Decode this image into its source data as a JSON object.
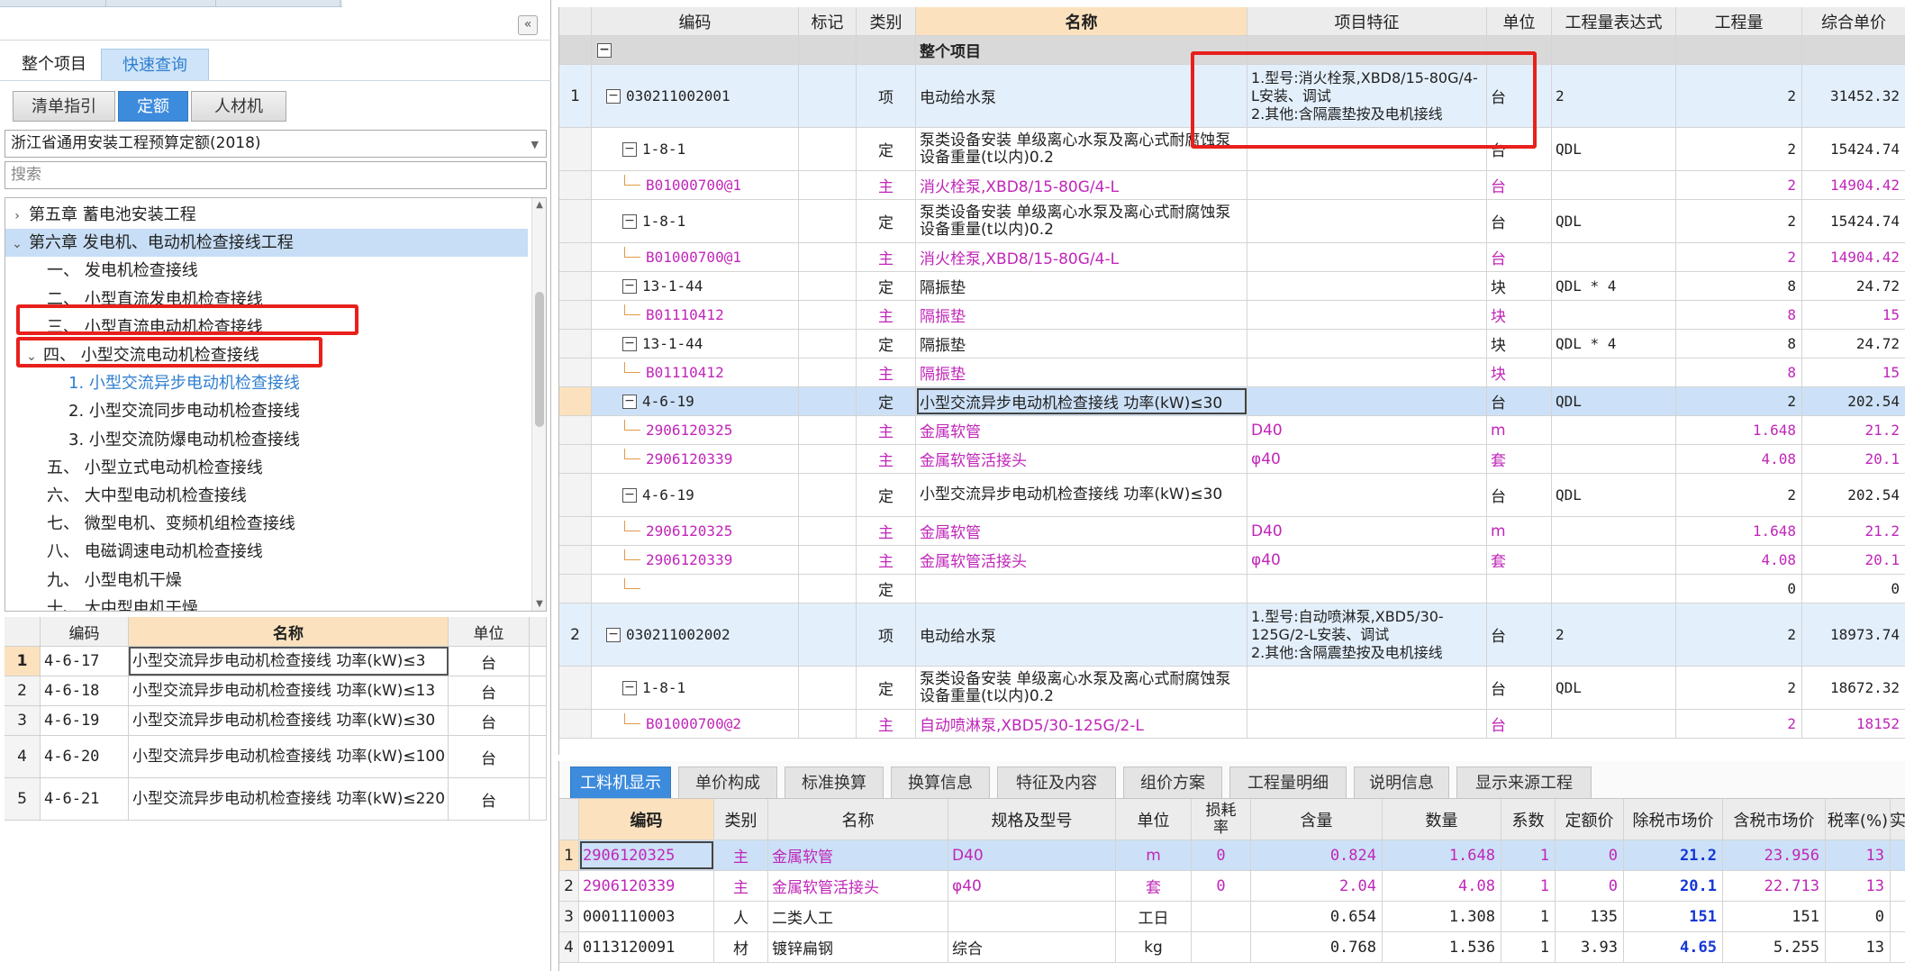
{
  "colors": {
    "accent": "#3d8bdc",
    "highlight_orange": "#fbe1bd",
    "main_material": "#c026b9",
    "red_annotation": "#e8201c",
    "bold_price": "#1437d6"
  },
  "left": {
    "collapse_icon": "«",
    "top_tabs": [
      "整个项目",
      "快速查询"
    ],
    "sub_tabs": [
      "清单指引",
      "定额",
      "人材机"
    ],
    "library": "浙江省通用安装工程预算定额(2018)",
    "search_placeholder": "搜索",
    "tree": [
      {
        "label": "第五章  蓄电池安装工程",
        "chev": "›"
      },
      {
        "label": "第六章  发电机、电动机检查接线工程",
        "chev": "⌄"
      },
      {
        "label": "一、  发电机检查接线",
        "chev": ""
      },
      {
        "label": "二、  小型直流发电机检查接线",
        "chev": ""
      },
      {
        "label": "三、  小型直流电动机检查接线",
        "chev": ""
      },
      {
        "label": "四、  小型交流电动机检查接线",
        "chev": "⌄"
      },
      {
        "label": "1.  小型交流异步电动机检查接线",
        "chev": ""
      },
      {
        "label": "2.  小型交流同步电动机检查接线",
        "chev": ""
      },
      {
        "label": "3.  小型交流防爆电动机检查接线",
        "chev": ""
      },
      {
        "label": "五、  小型立式电动机检查接线",
        "chev": ""
      },
      {
        "label": "六、  大中型电动机检查接线",
        "chev": ""
      },
      {
        "label": "七、  微型电机、变频机组检查接线",
        "chev": ""
      },
      {
        "label": "八、  电磁调速电动机检查接线",
        "chev": ""
      },
      {
        "label": "九、  小型电机干燥",
        "chev": ""
      },
      {
        "label": "十、  大中型电机干燥",
        "chev": ""
      }
    ],
    "quota_table": {
      "headers": [
        "编码",
        "名称",
        "单位"
      ],
      "rows": [
        {
          "num": "1",
          "code": "4-6-17",
          "name": "小型交流异步电动机检查接线 功率(kW)≤3",
          "unit": "台"
        },
        {
          "num": "2",
          "code": "4-6-18",
          "name": "小型交流异步电动机检查接线 功率(kW)≤13",
          "unit": "台"
        },
        {
          "num": "3",
          "code": "4-6-19",
          "name": "小型交流异步电动机检查接线 功率(kW)≤30",
          "unit": "台"
        },
        {
          "num": "4",
          "code": "4-6-20",
          "name": "小型交流异步电动机检查接线 功率(kW)≤100",
          "unit": "台"
        },
        {
          "num": "5",
          "code": "4-6-21",
          "name": "小型交流异步电动机检查接线 功率(kW)≤220",
          "unit": "台"
        }
      ]
    }
  },
  "grid": {
    "headers": [
      "",
      "编码",
      "标记",
      "类别",
      "名称",
      "项目特征",
      "单位",
      "工程量表达式",
      "工程量",
      "综合单价"
    ],
    "rows": [
      {
        "t": "group",
        "num": "",
        "code": "",
        "mark": "",
        "cat": "",
        "name": "整个项目",
        "feat": "",
        "unit": "",
        "expr": "",
        "qty": "",
        "price": ""
      },
      {
        "t": "xiang",
        "num": "1",
        "code": "030211002001",
        "mark": "",
        "cat": "项",
        "name": "电动给水泵",
        "feat": "1.型号:消火栓泵,XBD8/15-80G/4-L安装、调试\n2.其他:含隔震垫按及电机接线",
        "unit": "台",
        "expr": "2",
        "qty": "2",
        "price": "31452.32"
      },
      {
        "t": "ding",
        "num": "",
        "code": "1-8-1",
        "mark": "",
        "cat": "定",
        "name": "泵类设备安装 单级离心水泵及离心式耐腐蚀泵 设备重量(t以内)0.2",
        "feat": "",
        "unit": "台",
        "expr": "QDL",
        "qty": "2",
        "price": "15424.74"
      },
      {
        "t": "main",
        "num": "",
        "code": "B01000700@1",
        "mark": "",
        "cat": "主",
        "name": "消火栓泵,XBD8/15-80G/4-L",
        "feat": "",
        "unit": "台",
        "expr": "",
        "qty": "2",
        "price": "14904.42"
      },
      {
        "t": "ding",
        "num": "",
        "code": "1-8-1",
        "mark": "",
        "cat": "定",
        "name": "泵类设备安装 单级离心水泵及离心式耐腐蚀泵 设备重量(t以内)0.2",
        "feat": "",
        "unit": "台",
        "expr": "QDL",
        "qty": "2",
        "price": "15424.74"
      },
      {
        "t": "main",
        "num": "",
        "code": "B01000700@1",
        "mark": "",
        "cat": "主",
        "name": "消火栓泵,XBD8/15-80G/4-L",
        "feat": "",
        "unit": "台",
        "expr": "",
        "qty": "2",
        "price": "14904.42"
      },
      {
        "t": "ding",
        "num": "",
        "code": "13-1-44",
        "mark": "",
        "cat": "定",
        "name": "隔振垫",
        "feat": "",
        "unit": "块",
        "expr": "QDL * 4",
        "qty": "8",
        "price": "24.72"
      },
      {
        "t": "main",
        "num": "",
        "code": "B01110412",
        "mark": "",
        "cat": "主",
        "name": "隔振垫",
        "feat": "",
        "unit": "块",
        "expr": "",
        "qty": "8",
        "price": "15"
      },
      {
        "t": "ding",
        "num": "",
        "code": "13-1-44",
        "mark": "",
        "cat": "定",
        "name": "隔振垫",
        "feat": "",
        "unit": "块",
        "expr": "QDL * 4",
        "qty": "8",
        "price": "24.72"
      },
      {
        "t": "main",
        "num": "",
        "code": "B01110412",
        "mark": "",
        "cat": "主",
        "name": "隔振垫",
        "feat": "",
        "unit": "块",
        "expr": "",
        "qty": "8",
        "price": "15"
      },
      {
        "t": "dingsel",
        "num": "",
        "code": "4-6-19",
        "mark": "",
        "cat": "定",
        "name": "小型交流异步电动机检查接线 功率(kW)≤30",
        "feat": "",
        "unit": "台",
        "expr": "QDL",
        "qty": "2",
        "price": "202.54"
      },
      {
        "t": "main",
        "num": "",
        "code": "2906120325",
        "mark": "",
        "cat": "主",
        "name": "金属软管",
        "feat": "D40",
        "unit": "m",
        "expr": "",
        "qty": "1.648",
        "price": "21.2"
      },
      {
        "t": "main",
        "num": "",
        "code": "2906120339",
        "mark": "",
        "cat": "主",
        "name": "金属软管活接头",
        "feat": "φ40",
        "unit": "套",
        "expr": "",
        "qty": "4.08",
        "price": "20.1"
      },
      {
        "t": "ding",
        "num": "",
        "code": "4-6-19",
        "mark": "",
        "cat": "定",
        "name": "小型交流异步电动机检查接线 功率(kW)≤30",
        "feat": "",
        "unit": "台",
        "expr": "QDL",
        "qty": "2",
        "price": "202.54"
      },
      {
        "t": "main",
        "num": "",
        "code": "2906120325",
        "mark": "",
        "cat": "主",
        "name": "金属软管",
        "feat": "D40",
        "unit": "m",
        "expr": "",
        "qty": "1.648",
        "price": "21.2"
      },
      {
        "t": "main",
        "num": "",
        "code": "2906120339",
        "mark": "",
        "cat": "主",
        "name": "金属软管活接头",
        "feat": "φ40",
        "unit": "套",
        "expr": "",
        "qty": "4.08",
        "price": "20.1"
      },
      {
        "t": "empty",
        "num": "",
        "code": "",
        "mark": "",
        "cat": "定",
        "name": "",
        "feat": "",
        "unit": "",
        "expr": "",
        "qty": "0",
        "price": "0"
      },
      {
        "t": "xiang",
        "num": "2",
        "code": "030211002002",
        "mark": "",
        "cat": "项",
        "name": "电动给水泵",
        "feat": "1.型号:自动喷淋泵,XBD5/30-125G/2-L安装、调试\n2.其他:含隔震垫按及电机接线",
        "unit": "台",
        "expr": "2",
        "qty": "2",
        "price": "18973.74"
      },
      {
        "t": "ding",
        "num": "",
        "code": "1-8-1",
        "mark": "",
        "cat": "定",
        "name": "泵类设备安装 单级离心水泵及离心式耐腐蚀泵 设备重量(t以内)0.2",
        "feat": "",
        "unit": "台",
        "expr": "QDL",
        "qty": "2",
        "price": "18672.32"
      },
      {
        "t": "main",
        "num": "",
        "code": "B01000700@2",
        "mark": "",
        "cat": "主",
        "name": "自动喷淋泵,XBD5/30-125G/2-L",
        "feat": "",
        "unit": "台",
        "expr": "",
        "qty": "2",
        "price": "18152"
      }
    ]
  },
  "bottom": {
    "tabs": [
      "工料机显示",
      "单价构成",
      "标准换算",
      "换算信息",
      "特征及内容",
      "组价方案",
      "工程量明细",
      "说明信息",
      "显示来源工程"
    ],
    "headers": [
      "",
      "编码",
      "类别",
      "名称",
      "规格及型号",
      "单位",
      "损耗率",
      "含量",
      "数量",
      "系数",
      "定额价",
      "除税市场价",
      "含税市场价",
      "税率(%)",
      "实"
    ],
    "rows": [
      {
        "num": "1",
        "code": "2906120325",
        "cat": "主",
        "name": "金属软管",
        "spec": "D40",
        "unit": "m",
        "loss": "0",
        "content": "0.824",
        "qty": "1.648",
        "coef": "1",
        "quota": "0",
        "market": "21.2",
        "tax_market": "23.956",
        "tax": "13",
        "main": true
      },
      {
        "num": "2",
        "code": "2906120339",
        "cat": "主",
        "name": "金属软管活接头",
        "spec": "φ40",
        "unit": "套",
        "loss": "0",
        "content": "2.04",
        "qty": "4.08",
        "coef": "1",
        "quota": "0",
        "market": "20.1",
        "tax_market": "22.713",
        "tax": "13",
        "main": true
      },
      {
        "num": "3",
        "code": "0001110003",
        "cat": "人",
        "name": "二类人工",
        "spec": "",
        "unit": "工日",
        "loss": "",
        "content": "0.654",
        "qty": "1.308",
        "coef": "1",
        "quota": "135",
        "market": "151",
        "tax_market": "151",
        "tax": "0",
        "main": false
      },
      {
        "num": "4",
        "code": "0113120091",
        "cat": "材",
        "name": "镀锌扁钢",
        "spec": "综合",
        "unit": "kg",
        "loss": "",
        "content": "0.768",
        "qty": "1.536",
        "coef": "1",
        "quota": "3.93",
        "market": "4.65",
        "tax_market": "5.255",
        "tax": "13",
        "main": false
      }
    ]
  }
}
